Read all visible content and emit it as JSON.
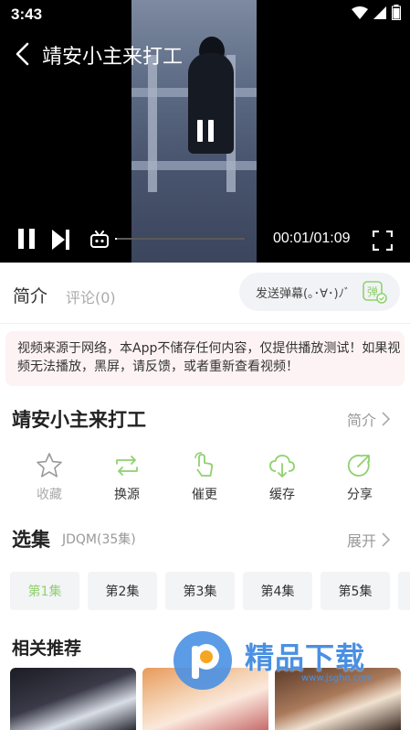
{
  "status_bar": {
    "time": "3:43"
  },
  "player": {
    "title": "靖安小主来打工",
    "time_display": "00:01/01:09",
    "progress": 0.015
  },
  "tabs": {
    "intro": "简介",
    "comments": "评论(0)",
    "danmu_placeholder": "发送弹幕(｡･∀･)ﾉﾞ",
    "danmu_button": "弹"
  },
  "notice": "视频来源于网络，本App不储存任何内容，仅提供播放测试！如果视频无法播放，黑屏，请反馈，或者重新查看视频！",
  "show": {
    "title": "靖安小主来打工",
    "intro_link": "简介"
  },
  "actions": [
    {
      "label": "收藏",
      "icon": "star-icon"
    },
    {
      "label": "换源",
      "icon": "switch-source-icon"
    },
    {
      "label": "催更",
      "icon": "urge-update-icon"
    },
    {
      "label": "缓存",
      "icon": "download-cloud-icon"
    },
    {
      "label": "分享",
      "icon": "share-icon"
    }
  ],
  "episodes": {
    "heading": "选集",
    "meta": "JDQM(35集)",
    "expand": "展开",
    "items": [
      "第1集",
      "第2集",
      "第3集",
      "第4集",
      "第5集"
    ],
    "active_index": 0
  },
  "recommendations": {
    "heading": "相关推荐"
  },
  "watermark": {
    "text": "精品下载",
    "url": "www.jsgho.com"
  },
  "colors": {
    "accent": "#8fd16f",
    "watermark": "#4a90e2"
  }
}
